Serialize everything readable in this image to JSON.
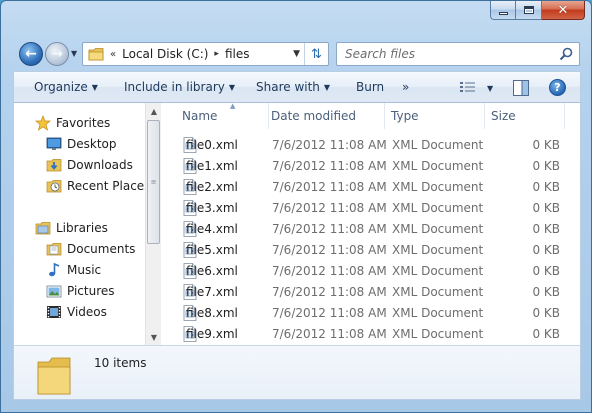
{
  "window": {
    "caption": {
      "minimize_icon": "minimize-icon",
      "maximize_icon": "maximize-icon",
      "close_icon": "close-icon",
      "close_glyph": "✕"
    }
  },
  "navigation": {
    "back_glyph": "←",
    "forward_glyph": "→"
  },
  "address": {
    "chevrons": "«",
    "location": "Local Disk (C:)",
    "separator": "▸",
    "folder": "files",
    "refresh_glyph": "⇅"
  },
  "search": {
    "placeholder": "Search files",
    "value": ""
  },
  "toolbar": {
    "organize": "Organize",
    "include": "Include in library",
    "share": "Share with",
    "burn": "Burn",
    "overflow": "»",
    "help_glyph": "?"
  },
  "sidebar": {
    "favorites": {
      "label": "Favorites",
      "items": [
        {
          "label": "Desktop",
          "icon": "desktop-icon"
        },
        {
          "label": "Downloads",
          "icon": "downloads-icon"
        },
        {
          "label": "Recent Places",
          "icon": "recent-places-icon"
        }
      ]
    },
    "libraries": {
      "label": "Libraries",
      "items": [
        {
          "label": "Documents",
          "icon": "documents-icon"
        },
        {
          "label": "Music",
          "icon": "music-icon"
        },
        {
          "label": "Pictures",
          "icon": "pictures-icon"
        },
        {
          "label": "Videos",
          "icon": "videos-icon"
        }
      ]
    }
  },
  "columns": {
    "name": "Name",
    "date": "Date modified",
    "type": "Type",
    "size": "Size"
  },
  "files": [
    {
      "name": "file0.xml",
      "date": "7/6/2012 11:08 AM",
      "type": "XML Document",
      "size": "0 KB"
    },
    {
      "name": "file1.xml",
      "date": "7/6/2012 11:08 AM",
      "type": "XML Document",
      "size": "0 KB"
    },
    {
      "name": "file2.xml",
      "date": "7/6/2012 11:08 AM",
      "type": "XML Document",
      "size": "0 KB"
    },
    {
      "name": "file3.xml",
      "date": "7/6/2012 11:08 AM",
      "type": "XML Document",
      "size": "0 KB"
    },
    {
      "name": "file4.xml",
      "date": "7/6/2012 11:08 AM",
      "type": "XML Document",
      "size": "0 KB"
    },
    {
      "name": "file5.xml",
      "date": "7/6/2012 11:08 AM",
      "type": "XML Document",
      "size": "0 KB"
    },
    {
      "name": "file6.xml",
      "date": "7/6/2012 11:08 AM",
      "type": "XML Document",
      "size": "0 KB"
    },
    {
      "name": "file7.xml",
      "date": "7/6/2012 11:08 AM",
      "type": "XML Document",
      "size": "0 KB"
    },
    {
      "name": "file8.xml",
      "date": "7/6/2012 11:08 AM",
      "type": "XML Document",
      "size": "0 KB"
    },
    {
      "name": "file9.xml",
      "date": "7/6/2012 11:08 AM",
      "type": "XML Document",
      "size": "0 KB"
    }
  ],
  "status": {
    "item_count": "10 items"
  }
}
